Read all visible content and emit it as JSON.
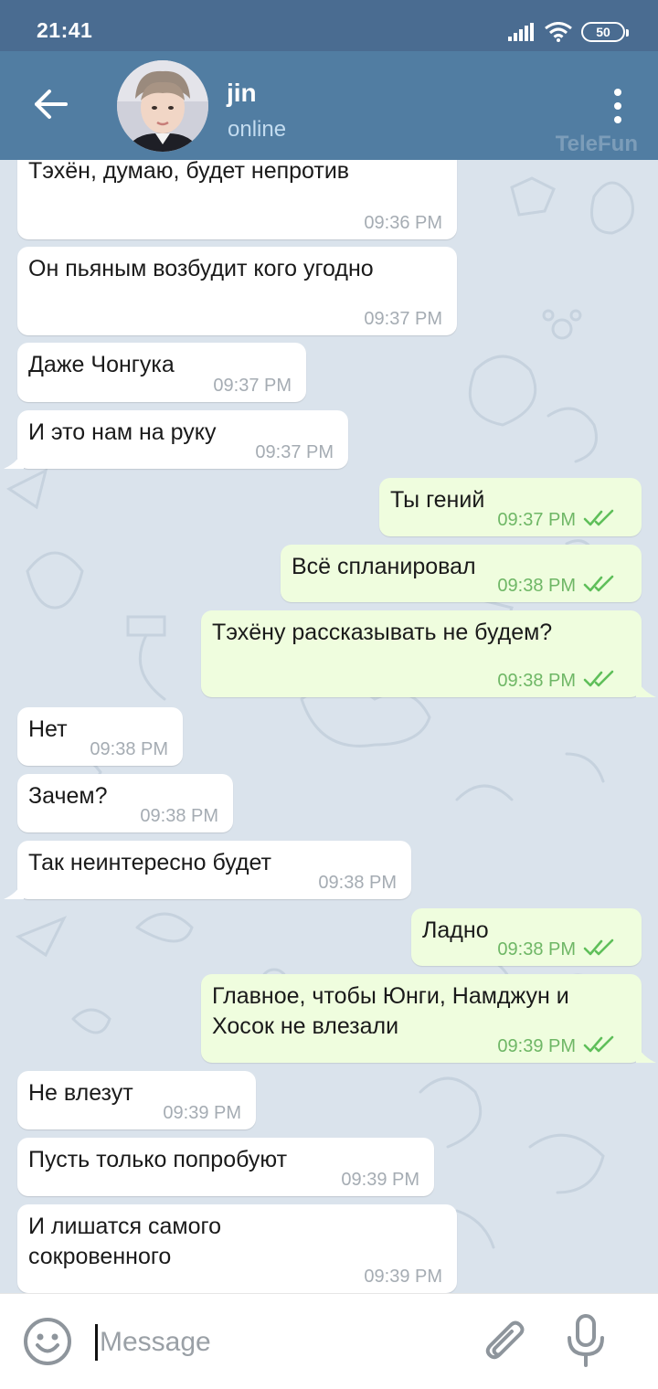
{
  "status_bar": {
    "time": "21:41",
    "battery": "50",
    "icons": [
      "signal-icon",
      "wifi-icon",
      "battery-icon"
    ]
  },
  "header": {
    "contact_name": "jin",
    "contact_status": "online",
    "watermark": "TeleFun",
    "icons": [
      "back-arrow-icon",
      "avatar",
      "more-vert-icon"
    ]
  },
  "messages": [
    {
      "dir": "in",
      "text": "Тэхён, думаю, будет непротив",
      "time": "09:36 PM"
    },
    {
      "dir": "in",
      "text": "Он пьяным возбудит кого угодно",
      "time": "09:37 PM"
    },
    {
      "dir": "in",
      "text": "Даже Чонгука",
      "time": "09:37 PM"
    },
    {
      "dir": "in",
      "text": "И это нам на руку",
      "time": "09:37 PM"
    },
    {
      "dir": "out",
      "text": "Ты гений",
      "time": "09:37 PM",
      "read": true
    },
    {
      "dir": "out",
      "text": "Всё спланировал",
      "time": "09:38 PM",
      "read": true
    },
    {
      "dir": "out",
      "text": "Тэхёну рассказывать не будем?",
      "time": "09:38 PM",
      "read": true
    },
    {
      "dir": "in",
      "text": "Нет",
      "time": "09:38 PM"
    },
    {
      "dir": "in",
      "text": "Зачем?",
      "time": "09:38 PM"
    },
    {
      "dir": "in",
      "text": "Так неинтересно будет",
      "time": "09:38 PM"
    },
    {
      "dir": "out",
      "text": "Ладно",
      "time": "09:38 PM",
      "read": true
    },
    {
      "dir": "out",
      "text": "Главное, чтобы Юнги, Намджун и Хосок не влезали",
      "time": "09:39 PM",
      "read": true
    },
    {
      "dir": "in",
      "text": "Не влезут",
      "time": "09:39 PM"
    },
    {
      "dir": "in",
      "text": "Пусть только попробуют",
      "time": "09:39 PM"
    },
    {
      "dir": "in",
      "text": "И лишатся самого сокровенного",
      "time": "09:39 PM"
    }
  ],
  "composer": {
    "placeholder": "Message",
    "icons": [
      "emoji-icon",
      "attach-icon",
      "mic-icon"
    ]
  },
  "colors": {
    "header": "#517da2",
    "status_bar": "#4a6c91",
    "incoming_bubble": "#ffffff",
    "outgoing_bubble": "#effdde",
    "read_check": "#5fbf5a",
    "chat_background": "#dae3ec"
  }
}
